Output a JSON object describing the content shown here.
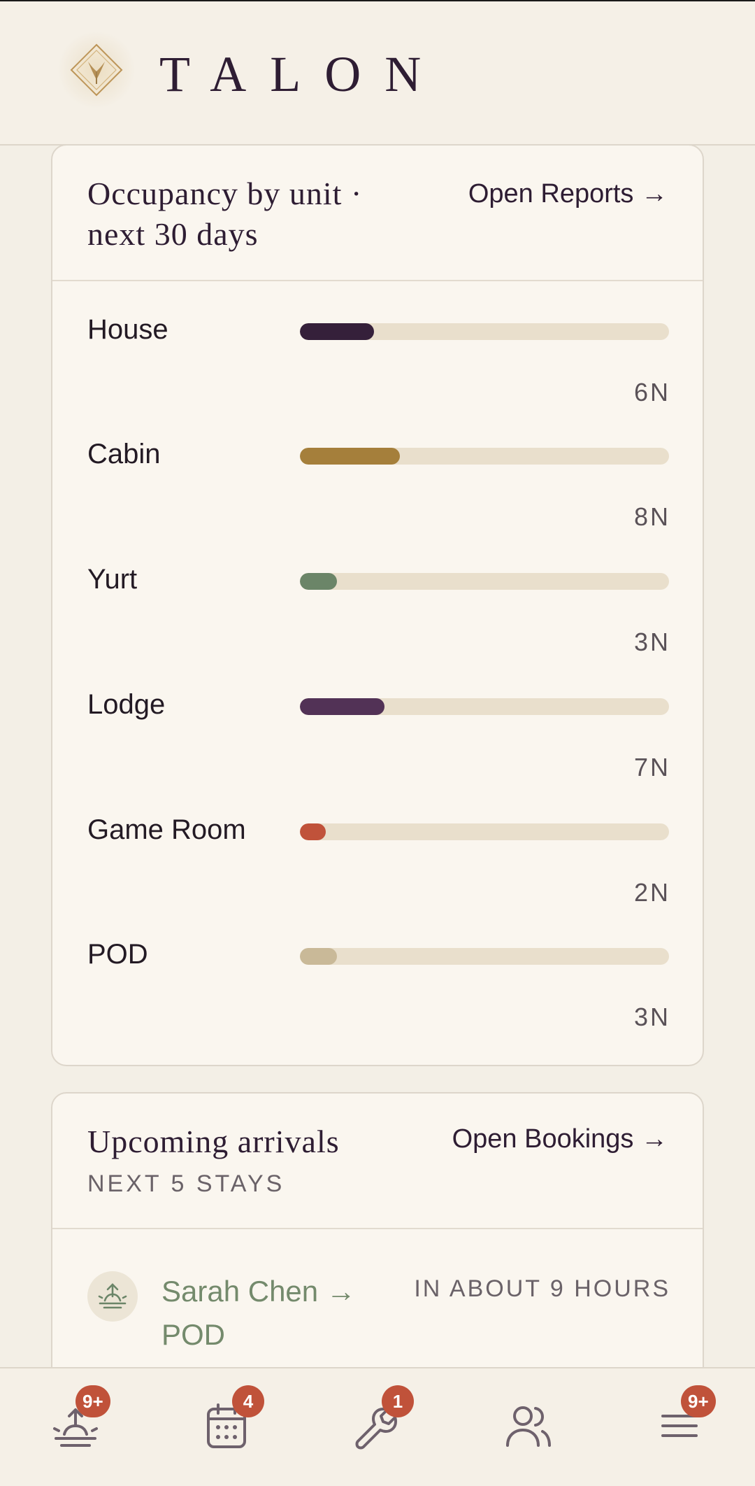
{
  "app": {
    "brand": "TALON"
  },
  "occupancy": {
    "title": "Occupancy by unit · next 30 days",
    "link": "Open Reports →",
    "units": [
      {
        "name": "House",
        "nights": "6N",
        "fill": 0.2,
        "color": "#35203a"
      },
      {
        "name": "Cabin",
        "nights": "8N",
        "fill": 0.27,
        "color": "#a57f3b"
      },
      {
        "name": "Yurt",
        "nights": "3N",
        "fill": 0.1,
        "color": "#6b8568"
      },
      {
        "name": "Lodge",
        "nights": "7N",
        "fill": 0.23,
        "color": "#523256"
      },
      {
        "name": "Game Room",
        "nights": "2N",
        "fill": 0.07,
        "color": "#c0523a"
      },
      {
        "name": "POD",
        "nights": "3N",
        "fill": 0.1,
        "color": "#c9b998"
      }
    ]
  },
  "arrivals": {
    "title": "Upcoming arrivals",
    "subtitle": "NEXT 5 STAYS",
    "link": "Open Bookings →",
    "items": [
      {
        "guest": "Sarah Chen → POD",
        "when": "IN ABOUT 9 HOURS",
        "icon": "sunrise-icon"
      }
    ]
  },
  "nav": {
    "items": [
      {
        "icon": "sunrise-icon",
        "badge": "9+"
      },
      {
        "icon": "calendar-icon",
        "badge": "4"
      },
      {
        "icon": "wrench-icon",
        "badge": "1"
      },
      {
        "icon": "users-icon",
        "badge": ""
      },
      {
        "icon": "menu-icon",
        "badge": "9+"
      }
    ]
  },
  "colors": {
    "accent": "#c0523a",
    "brand": "#2e1d33",
    "sage": "#748a6c",
    "track": "#e9dfcc"
  }
}
